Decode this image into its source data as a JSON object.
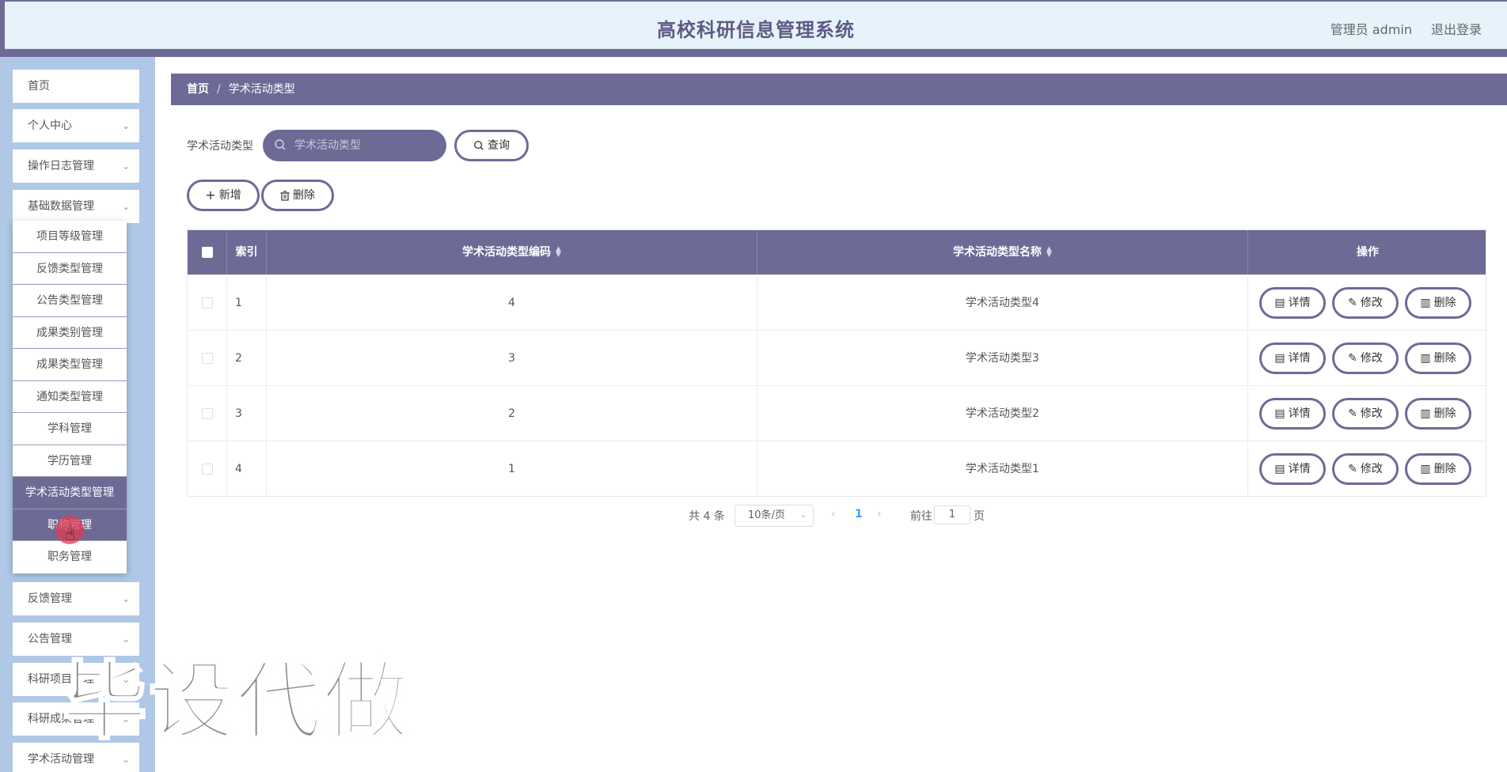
{
  "header": {
    "title": "高校科研信息管理系统",
    "user": "管理员 admin",
    "logout": "退出登录"
  },
  "sidebar": {
    "items_top": [
      {
        "label": "首页",
        "has_chevron": false
      },
      {
        "label": "个人中心",
        "has_chevron": true
      },
      {
        "label": "操作日志管理",
        "has_chevron": true
      },
      {
        "label": "基础数据管理",
        "has_chevron": true
      }
    ],
    "submenu": [
      {
        "label": "项目等级管理"
      },
      {
        "label": "反馈类型管理"
      },
      {
        "label": "公告类型管理"
      },
      {
        "label": "成果类别管理"
      },
      {
        "label": "成果类型管理"
      },
      {
        "label": "通知类型管理"
      },
      {
        "label": "学科管理"
      },
      {
        "label": "学历管理"
      },
      {
        "label": "学术活动类型管理"
      },
      {
        "label": "职称管理"
      },
      {
        "label": "职务管理"
      }
    ],
    "items_bottom": [
      {
        "label": "反馈管理"
      },
      {
        "label": "公告管理"
      },
      {
        "label": "科研项目管理"
      },
      {
        "label": "科研成果管理"
      },
      {
        "label": "学术活动管理"
      }
    ]
  },
  "breadcrumb": {
    "home": "首页",
    "separator": "/",
    "current": "学术活动类型"
  },
  "search": {
    "label": "学术活动类型",
    "placeholder": "学术活动类型",
    "button": "查询"
  },
  "toolbar": {
    "add": "新增",
    "delete": "删除"
  },
  "table": {
    "headers": [
      "索引",
      "学术活动类型编码",
      "学术活动类型名称",
      "操作"
    ],
    "rows": [
      {
        "index": "1",
        "code": "4",
        "name": "学术活动类型4"
      },
      {
        "index": "2",
        "code": "3",
        "name": "学术活动类型3"
      },
      {
        "index": "3",
        "code": "2",
        "name": "学术活动类型2"
      },
      {
        "index": "4",
        "code": "1",
        "name": "学术活动类型1"
      }
    ],
    "actions": {
      "detail": "详情",
      "edit": "修改",
      "delete": "删除"
    }
  },
  "pagination": {
    "total": "共 4 条",
    "page_size": "10条/页",
    "current": "1",
    "goto_prefix": "前往",
    "goto_value": "1",
    "goto_suffix": "页"
  },
  "watermark": "毕设代做",
  "colors": {
    "primary": "#6e6a96",
    "header_bg": "#e6f3fb",
    "sidebar_bg": "#aec8e6"
  }
}
